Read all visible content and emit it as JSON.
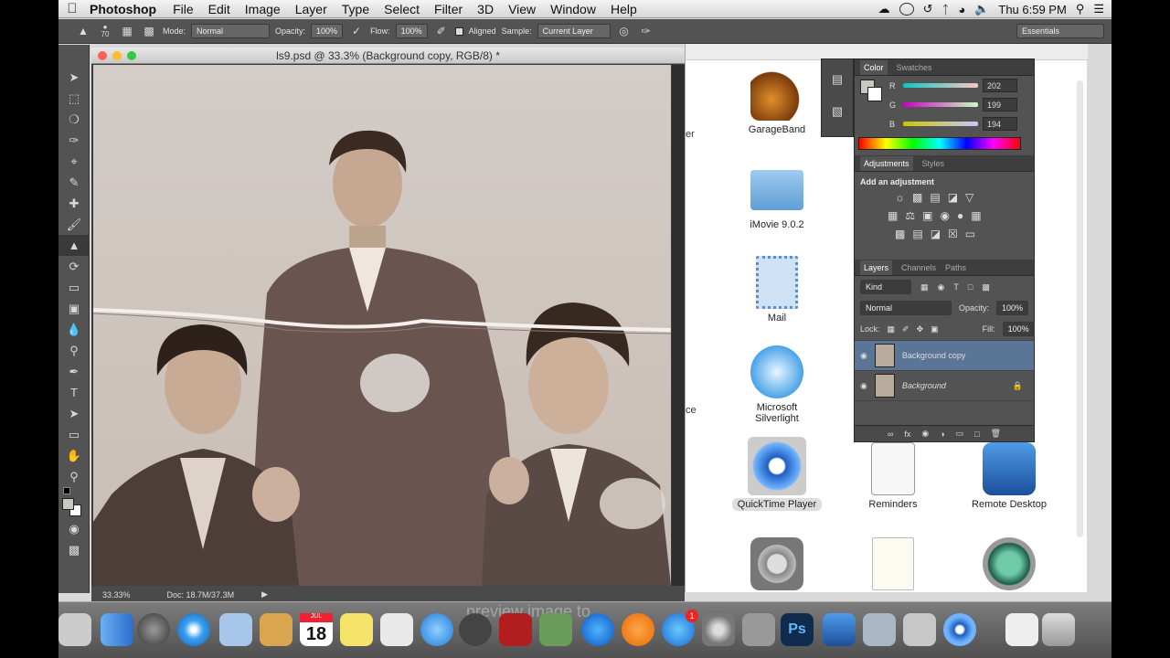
{
  "menubar": {
    "app_name": "Photoshop",
    "items": [
      "File",
      "Edit",
      "Image",
      "Layer",
      "Type",
      "Select",
      "Filter",
      "3D",
      "View",
      "Window",
      "Help"
    ],
    "clock": "Thu 6:59 PM"
  },
  "options_bar": {
    "brush_size": "70",
    "mode_label": "Mode:",
    "mode_value": "Normal",
    "opacity_label": "Opacity:",
    "opacity_value": "100%",
    "flow_label": "Flow:",
    "flow_value": "100%",
    "aligned_label": "Aligned",
    "sample_label": "Sample:",
    "sample_value": "Current Layer",
    "workspace": "Essentials"
  },
  "document": {
    "title": "ls9.psd @ 33.3% (Background copy, RGB/8) *",
    "zoom": "33.33%",
    "doc_size": "Doc: 18.7M/37.3M"
  },
  "color_panel": {
    "tabs": [
      "Color",
      "Swatches"
    ],
    "r_label": "R",
    "r_value": "202",
    "g_label": "G",
    "g_value": "199",
    "b_label": "B",
    "b_value": "194",
    "fg_color": "#cac7c2"
  },
  "adjustments_panel": {
    "tabs": [
      "Adjustments",
      "Styles"
    ],
    "heading": "Add an adjustment"
  },
  "layers_panel": {
    "tabs": [
      "Layers",
      "Channels",
      "Paths"
    ],
    "filter_label": "Kind",
    "blend_mode": "Normal",
    "opacity_label": "Opacity:",
    "opacity_value": "100%",
    "lock_label": "Lock:",
    "fill_label": "Fill:",
    "fill_value": "100%",
    "layers": [
      {
        "name": "Background copy",
        "selected": true
      },
      {
        "name": "Background",
        "selected": false
      }
    ]
  },
  "finder": {
    "apps": [
      {
        "name": "GarageBand"
      },
      {
        "name": "iMovie 9.0.2"
      },
      {
        "name": "Mail"
      },
      {
        "name": "Microsoft\nSilverlight"
      },
      {
        "name": "QuickTime Player"
      },
      {
        "name": "Reminders"
      },
      {
        "name": "Remote Desktop"
      }
    ],
    "partial_labels": [
      "er",
      "ce"
    ]
  },
  "dock": {
    "overlay_text": "preview image to",
    "calendar_day": "18",
    "calendar_month": "JUL",
    "badge": "1",
    "ps_label": "Ps"
  }
}
